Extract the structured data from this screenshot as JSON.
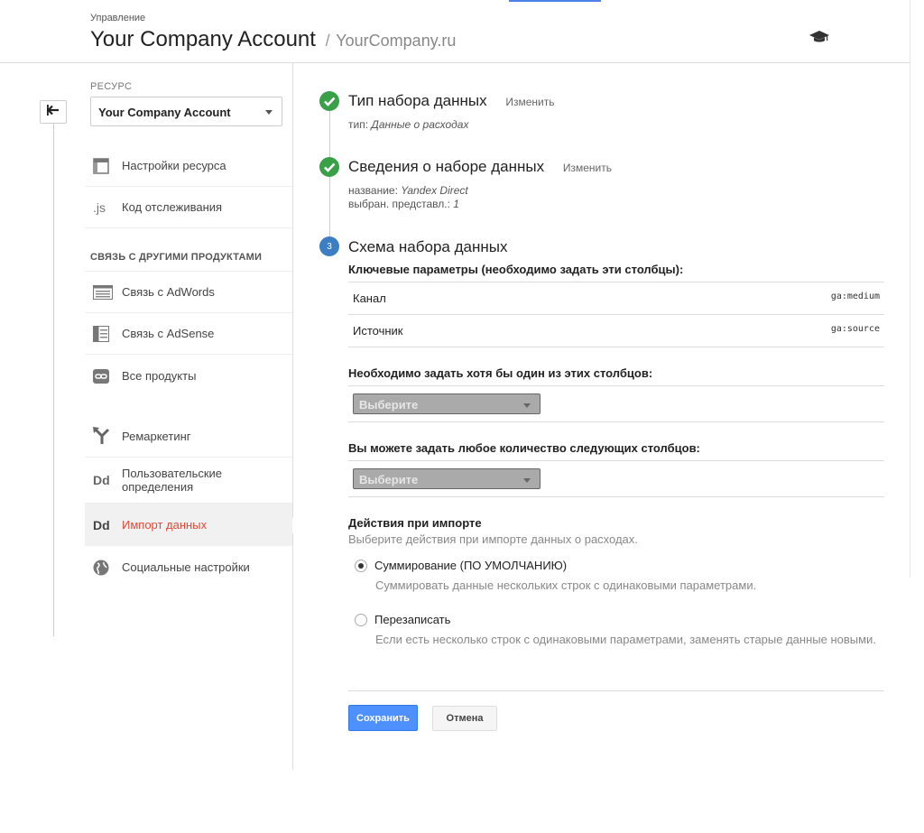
{
  "header": {
    "breadcrumb": "Управление",
    "account_name": "Your Company Account",
    "separator": "/",
    "property_url": "YourCompany.ru",
    "icon": "graduation-cap-icon"
  },
  "sidebar": {
    "resource_label": "РЕСУРС",
    "resource_selected": "Your Company Account",
    "items_top": [
      {
        "label": "Настройки ресурса",
        "icon": "property-settings-icon"
      },
      {
        "label": "Код отслеживания",
        "icon": "js-icon"
      }
    ],
    "section_title": "СВЯЗЬ С ДРУГИМИ ПРОДУКТАМИ",
    "items_links": [
      {
        "label": "Связь с AdWords",
        "icon": "adwords-icon"
      },
      {
        "label": "Связь с AdSense",
        "icon": "adsense-icon"
      },
      {
        "label": "Все продукты",
        "icon": "link-icon"
      }
    ],
    "items_other": [
      {
        "label": "Ремаркетинг",
        "icon": "remarketing-icon"
      },
      {
        "label": "Пользовательские определения",
        "icon": "dd-icon"
      },
      {
        "label": "Импорт данных",
        "icon": "dd-icon"
      },
      {
        "label": "Социальные настройки",
        "icon": "globe-icon"
      }
    ],
    "js_glyph": ".js",
    "dd_glyph": "Dd"
  },
  "steps": {
    "step1": {
      "title": "Тип набора данных",
      "change": "Изменить",
      "detail_label": "тип:",
      "detail_value": "Данные о расходах"
    },
    "step2": {
      "title": "Сведения о наборе данных",
      "change": "Изменить",
      "name_label": "название:",
      "name_value": "Yandex Direct",
      "views_label": "выбран. представл.:",
      "views_value": "1"
    },
    "step3": {
      "number": "3",
      "title": "Схема набора данных"
    }
  },
  "schema": {
    "key_params_label": "Ключевые параметры (необходимо задать эти столбцы):",
    "key_rows": [
      {
        "name": "Канал",
        "code": "ga:medium"
      },
      {
        "name": "Источник",
        "code": "ga:source"
      }
    ],
    "required_label": "Необходимо задать хотя бы один из этих столбцов:",
    "required_select": "Выберите",
    "optional_label": "Вы можете задать любое количество следующих столбцов:",
    "optional_select": "Выберите"
  },
  "import_actions": {
    "title": "Действия при импорте",
    "subtitle": "Выберите действия при импорте данных о расходах.",
    "options": [
      {
        "label": "Суммирование (ПО УМОЛЧАНИЮ)",
        "desc": "Суммировать данные нескольких строк с одинаковыми параметрами.",
        "selected": true
      },
      {
        "label": "Перезаписать",
        "desc": "Если есть несколько строк с одинаковыми параметрами, заменять старые данные новыми.",
        "selected": false
      }
    ]
  },
  "buttons": {
    "save": "Сохранить",
    "cancel": "Отмена"
  },
  "colors": {
    "accent": "#4d90fe",
    "active_nav": "#dd4b39",
    "done_step": "#3aa047",
    "current_step": "#3b7ec4"
  }
}
